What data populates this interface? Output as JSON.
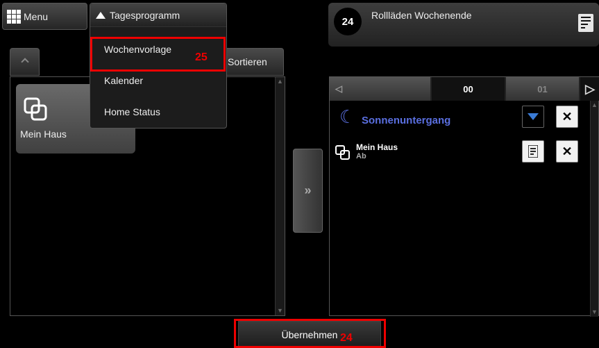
{
  "menu": {
    "label": "Menu"
  },
  "dropdown": {
    "header": "Tagesprogramm",
    "items": [
      {
        "label": "Wochenvorlage"
      },
      {
        "label": "Kalender"
      },
      {
        "label": "Home Status"
      }
    ],
    "annotation": "25"
  },
  "left_panel": {
    "sort_label": "Sortieren",
    "tile": {
      "label": "Mein Haus",
      "icon": "copy-icon"
    }
  },
  "transfer": {
    "label": "»"
  },
  "right_header": {
    "clock_number": "24",
    "title": "Rollläden Wochenende"
  },
  "day_bar": {
    "prev": "◁",
    "current": "00",
    "next_day": "01",
    "next": "▷"
  },
  "schedule": {
    "event": {
      "label": "Sonnenuntergang",
      "icon": "moon-icon"
    },
    "device": {
      "name": "Mein Haus",
      "action": "Ab"
    }
  },
  "footer": {
    "apply_label": "Übernehmen",
    "annotation": "24"
  },
  "colors": {
    "accent": "#5a6fe0",
    "highlight": "#e00000"
  }
}
